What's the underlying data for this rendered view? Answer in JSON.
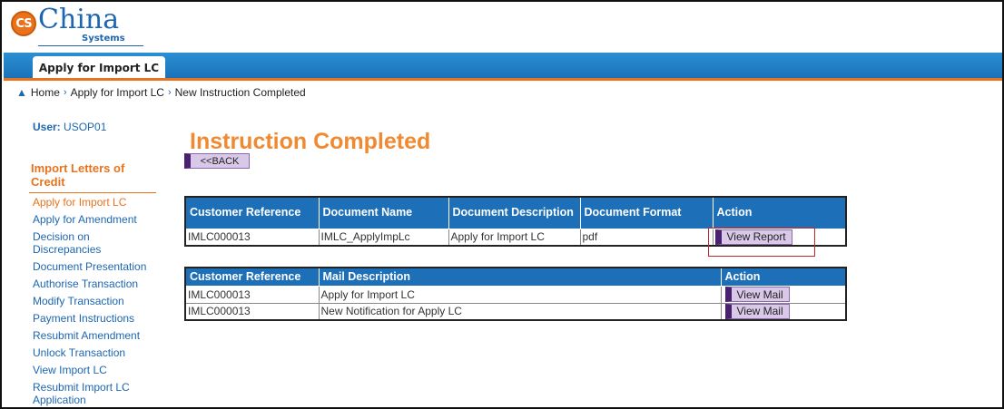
{
  "header": {
    "logo_badge": "CS",
    "logo_word": "China",
    "logo_sub": "Systems"
  },
  "tab": {
    "label": "Apply for Import LC"
  },
  "breadcrumb": {
    "items": [
      "Home",
      "Apply for Import LC",
      "New Instruction Completed"
    ]
  },
  "user": {
    "label": "User:",
    "value": "USOP01"
  },
  "sidebar": {
    "heading": "Import Letters of Credit",
    "items": [
      {
        "label": "Apply for Import LC",
        "active": true
      },
      {
        "label": "Apply for Amendment"
      },
      {
        "label": "Decision on Discrepancies"
      },
      {
        "label": "Document Presentation"
      },
      {
        "label": "Authorise Transaction"
      },
      {
        "label": "Modify Transaction"
      },
      {
        "label": "Payment Instructions"
      },
      {
        "label": "Resubmit Amendment"
      },
      {
        "label": "Unlock Transaction"
      },
      {
        "label": "View Import LC"
      },
      {
        "label": "Resubmit Import LC Application"
      }
    ]
  },
  "main": {
    "title": "Instruction Completed",
    "back_label": "<<BACK",
    "documents": {
      "headers": [
        "Customer Reference",
        "Document Name",
        "Document Description",
        "Document Format",
        "Action"
      ],
      "rows": [
        {
          "ref": "IMLC000013",
          "name": "IMLC_ApplyImpLc",
          "desc": "Apply for Import LC",
          "format": "pdf",
          "action": "View Report"
        }
      ]
    },
    "mails": {
      "headers": [
        "Customer Reference",
        "Mail Description",
        "Action"
      ],
      "rows": [
        {
          "ref": "IMLC000013",
          "desc": "Apply for Import LC",
          "action": "View Mail"
        },
        {
          "ref": "IMLC000013",
          "desc": "New Notification for Apply LC",
          "action": "View Mail"
        }
      ]
    }
  },
  "colors": {
    "brand_blue": "#1d66b0",
    "accent_orange": "#e8731c",
    "highlight_red": "#c0282a"
  }
}
